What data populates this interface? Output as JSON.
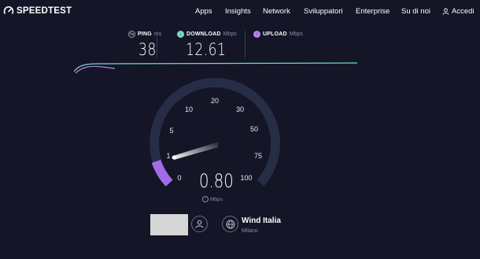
{
  "header": {
    "logo_text": "SPEEDTEST",
    "nav": [
      {
        "label": "Apps"
      },
      {
        "label": "Insights"
      },
      {
        "label": "Network"
      },
      {
        "label": "Sviluppatori"
      },
      {
        "label": "Enterprise"
      },
      {
        "label": "Su di noi"
      },
      {
        "label": "Accedi",
        "icon": "user-icon"
      }
    ]
  },
  "metrics": {
    "ping": {
      "label": "PING",
      "unit": "ms",
      "value": "38",
      "icon": "ping-icon"
    },
    "download": {
      "label": "DOWNLOAD",
      "unit": "Mbps",
      "value": "12.61",
      "icon": "download-icon"
    },
    "upload": {
      "label": "UPLOAD",
      "unit": "Mbps",
      "value": "",
      "icon": "upload-icon"
    }
  },
  "gauge": {
    "ticks": [
      "0",
      "1",
      "5",
      "10",
      "20",
      "30",
      "50",
      "75",
      "100"
    ],
    "value": "0.80",
    "unit": "Mbps",
    "unit_icon": "upload-icon",
    "colors": {
      "track": "#2a3046",
      "progress": "#a26bea",
      "accent_dl": "#7ad6c8",
      "accent_ul": "#b783f0"
    }
  },
  "server": {
    "isp": "Wind Italia",
    "city": "Milano",
    "user_icon": "user-icon",
    "globe_icon": "globe-icon"
  }
}
